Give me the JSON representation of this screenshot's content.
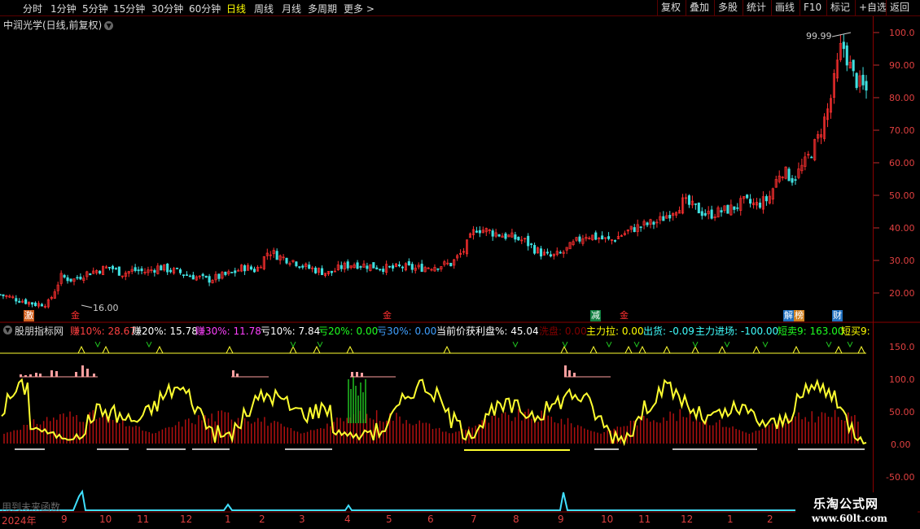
{
  "toolbar": {
    "periods": [
      "分时",
      "1分钟",
      "5分钟",
      "15分钟",
      "30分钟",
      "60分钟",
      "日线",
      "周线",
      "月线",
      "多周期",
      "更多 >"
    ],
    "active_period": "日线",
    "buttons": [
      "复权",
      "叠加",
      "多股",
      "统计",
      "画线",
      "F10",
      "标记",
      "+自选",
      "返回"
    ]
  },
  "chart": {
    "title": "中润光学(日线,前复权)",
    "price_axis": [
      "100.0",
      "90.00",
      "80.00",
      "70.00",
      "60.00",
      "50.00",
      "40.00",
      "30.00",
      "20.00"
    ],
    "high_label": "99.99",
    "low_label": "16.00",
    "signals": [
      {
        "text": "激",
        "kind": "orange"
      },
      {
        "text": "金",
        "kind": "red"
      },
      {
        "text": "金",
        "kind": "red"
      },
      {
        "text": "减",
        "kind": "green"
      },
      {
        "text": "金",
        "kind": "red"
      },
      {
        "text": "解",
        "kind": "blue"
      },
      {
        "text": "榜",
        "kind": "orange"
      },
      {
        "text": "财",
        "kind": "blue"
      }
    ]
  },
  "indicator": {
    "name": "股朋指标网",
    "items": [
      {
        "text": "赚10%: 28.67",
        "color": "#ff4040"
      },
      {
        "text": "赚20%: 15.78",
        "color": "#ffffff"
      },
      {
        "text": "赚30%: 11.78",
        "color": "#ff40ff"
      },
      {
        "text": "亏10%: 7.84",
        "color": "#ffffff"
      },
      {
        "text": "亏20%: 0.00",
        "color": "#20ff20"
      },
      {
        "text": "亏30%: 0.00",
        "color": "#40a0ff"
      },
      {
        "text": "当前价获利盘%: 45.04",
        "color": "#ffffff"
      },
      {
        "text": "洗盘: 0.00",
        "color": "#800000"
      },
      {
        "text": "主力拉: 0.00",
        "color": "#ffff00"
      },
      {
        "text": "出货: -0.09",
        "color": "#40ffff"
      },
      {
        "text": "主力进场: -100.00",
        "color": "#40ffff"
      },
      {
        "text": "短卖9: 163.00",
        "color": "#20ff20"
      },
      {
        "text": "短买9:",
        "color": "#ffff00"
      }
    ],
    "axis": [
      "150.0",
      "100.0",
      "50.00",
      "0.00",
      "-50.00"
    ],
    "footer_text": "用到未来函数"
  },
  "date_axis": [
    "2024年",
    "9",
    "10",
    "11",
    "12",
    "1",
    "2",
    "3",
    "4",
    "5",
    "6",
    "7",
    "8",
    "9",
    "10",
    "11",
    "12",
    "1",
    "2"
  ],
  "watermark": {
    "title": "乐淘公式网",
    "url": "www.60lt.com"
  },
  "colors": {
    "up": "#ff3030",
    "down": "#40e0e0",
    "yellow_line": "#ffff30",
    "axis": "#e04040"
  },
  "chart_data": {
    "type": "candlestick",
    "approx_close_path": [
      19.5,
      18.5,
      17.5,
      16.5,
      17,
      25,
      24,
      26,
      27,
      28,
      26,
      27,
      26.5,
      28,
      27,
      26,
      25,
      24,
      25,
      26,
      28,
      27,
      33,
      31,
      30,
      28,
      27,
      26,
      28,
      29,
      28.5,
      28,
      27.5,
      28,
      27.5,
      28,
      28.5,
      29,
      33,
      40,
      39,
      38,
      37,
      36,
      33,
      31,
      32,
      35,
      38,
      37,
      36,
      38,
      40,
      41,
      42,
      45,
      48,
      46,
      44,
      45,
      46,
      48,
      47,
      49,
      58,
      55,
      60,
      67,
      78,
      97,
      86,
      82
    ],
    "ylim": [
      15,
      100
    ],
    "indicator_ylim": [
      -50,
      150
    ]
  }
}
